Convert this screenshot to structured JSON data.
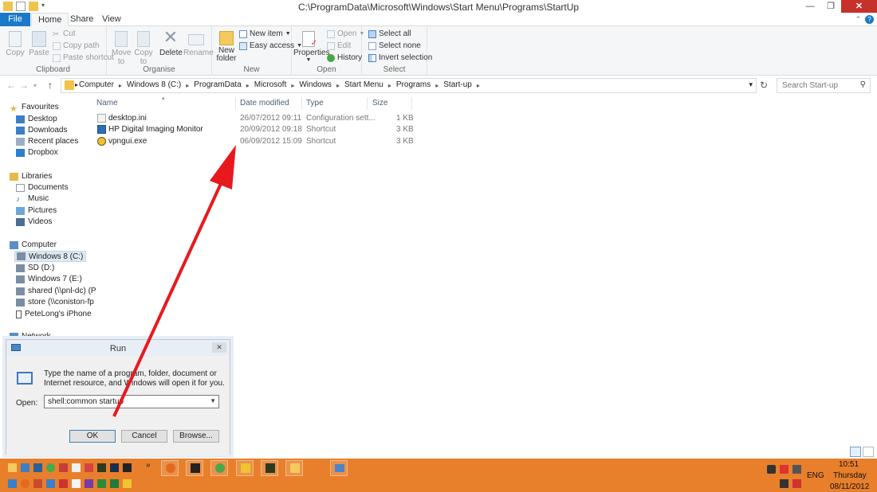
{
  "window": {
    "title": "C:\\ProgramData\\Microsoft\\Windows\\Start Menu\\Programs\\StartUp",
    "close_glyph": "✕",
    "min_glyph": "—",
    "max_glyph": "❐"
  },
  "tabs": [
    "File",
    "Home",
    "Share",
    "View"
  ],
  "ribbon": {
    "clipboard": {
      "label": "Clipboard",
      "copy": "Copy",
      "paste": "Paste",
      "cut": "Cut",
      "copy_path": "Copy path",
      "paste_shortcut": "Paste shortcut"
    },
    "organise": {
      "label": "Organise",
      "move_to": "Move to",
      "copy_to": "Copy to",
      "delete": "Delete",
      "rename": "Rename"
    },
    "new": {
      "label": "New",
      "new_folder": "New folder",
      "new_item": "New item",
      "easy_access": "Easy access"
    },
    "open": {
      "label": "Open",
      "properties": "Properties",
      "open": "Open",
      "edit": "Edit",
      "history": "History"
    },
    "select": {
      "label": "Select",
      "select_all": "Select all",
      "select_none": "Select none",
      "invert_selection": "Invert selection"
    }
  },
  "address": {
    "crumbs": [
      "Computer",
      "Windows 8 (C:)",
      "ProgramData",
      "Microsoft",
      "Windows",
      "Start Menu",
      "Programs",
      "Start-up"
    ],
    "search_placeholder": "Search Start-up"
  },
  "nav": {
    "favourites": "Favourites",
    "desktop": "Desktop",
    "downloads": "Downloads",
    "recent_places": "Recent places",
    "dropbox": "Dropbox",
    "libraries": "Libraries",
    "documents": "Documents",
    "music": "Music",
    "pictures": "Pictures",
    "videos": "Videos",
    "computer": "Computer",
    "drive_c": "Windows 8 (C:)",
    "drive_d": "SD (D:)",
    "drive_e": "Windows 7 (E:)",
    "shared": "shared (\\\\pnl-dc) (P",
    "store": "store (\\\\coniston-fp",
    "iphone": "PeteLong's iPhone",
    "network": "Network"
  },
  "columns": {
    "name": "Name",
    "date": "Date modified",
    "type": "Type",
    "size": "Size"
  },
  "files": [
    {
      "name": "desktop.ini",
      "date": "26/07/2012 09:11",
      "type": "Configuration sett...",
      "size": "1 KB",
      "icon": "settings-file-icon"
    },
    {
      "name": "HP Digital Imaging Monitor",
      "date": "20/09/2012 09:18",
      "type": "Shortcut",
      "size": "3 KB",
      "icon": "shortcut-icon"
    },
    {
      "name": "vpngui.exe",
      "date": "06/09/2012 15:09",
      "type": "Shortcut",
      "size": "3 KB",
      "icon": "vpn-icon"
    }
  ],
  "run_dialog": {
    "title": "Run",
    "description": "Type the name of a program, folder, document or Internet resource, and Windows will open it for you.",
    "open_label": "Open:",
    "input_value": "shell:common startup",
    "ok": "OK",
    "cancel": "Cancel",
    "browse": "Browse..."
  },
  "tray": {
    "time": "10:51",
    "day": "Thursday",
    "date": "08/11/2012",
    "lang": "ENG"
  },
  "colors": {
    "accent": "#1979ca",
    "taskbar": "#e87f2b",
    "arrow": "#e8191e"
  }
}
